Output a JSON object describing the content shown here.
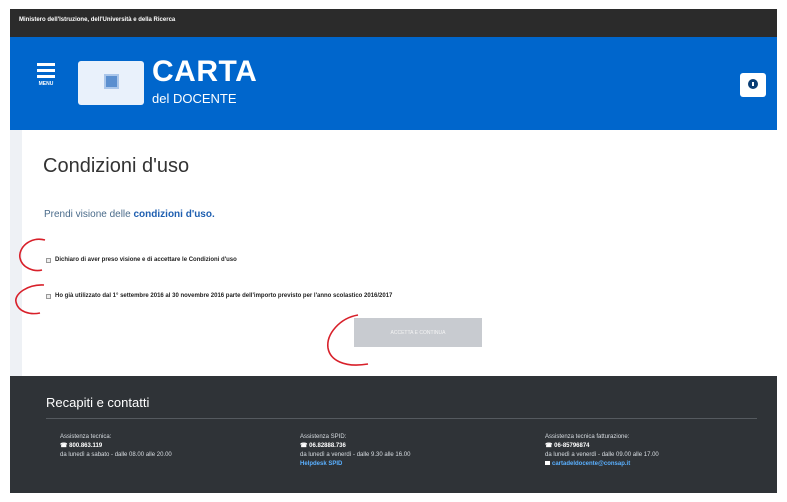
{
  "ministry": {
    "text": "Ministero dell'Istruzione, dell'Università e della Ricerca"
  },
  "header": {
    "menu_label": "MENU",
    "logo_title": "CARTA",
    "logo_subtitle": "del DOCENTE"
  },
  "main": {
    "title": "Condizioni d'uso",
    "intro_text": "Prendi visione delle",
    "intro_link": "condizioni d'uso.",
    "checkbox_1": "Dichiaro di aver preso visione e di accettare le Condizioni d'uso",
    "checkbox_2": "Ho già utilizzato dal 1° settembre 2016 al 30 novembre 2016 parte dell'importo previsto per l'anno scolastico 2016/2017",
    "proceed_button": "ACCETTA E CONTINUA"
  },
  "footer": {
    "title": "Recapiti e contatti",
    "contacts": [
      {
        "label": "Assistenza tecnica:",
        "phone": "☎ 800.863.119",
        "hours": "da lunedì a sabato - dalle 08.00 alle 20.00",
        "link": ""
      },
      {
        "label": "Assistenza SPID:",
        "phone": "☎ 06.82888.736",
        "hours": "da lunedì a venerdì - dalle 9.30 alle 16.00",
        "link": "Helpdesk SPID"
      },
      {
        "label": "Assistenza tecnica fatturazione:",
        "phone": "☎ 06-85796874",
        "hours": "da lunedì a venerdì - dalle 09.00 alle 17.00",
        "link": "cartadeldocente@consap.it"
      }
    ]
  },
  "colors": {
    "brand_blue": "#0066cc",
    "footer_bg": "#2f3337",
    "ministry_bg": "#2b2b2b",
    "annotation_red": "#d8202a"
  }
}
